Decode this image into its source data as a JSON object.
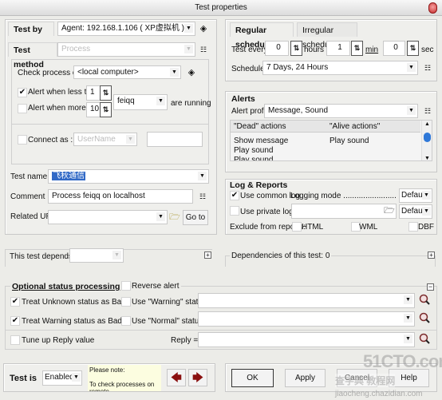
{
  "window": {
    "title": "Test properties"
  },
  "left": {
    "test_by": {
      "label": "Test by",
      "value": "Agent: 192.168.1.106 ( XP虚拟机 )"
    },
    "test_method": {
      "label": "Test method",
      "value": "Process"
    },
    "check_process_on": {
      "label": "Check process on",
      "value": "<local computer>"
    },
    "alert_less": {
      "label": "Alert when less than",
      "checked": true,
      "value": "1"
    },
    "alert_more": {
      "label": "Alert when more than",
      "checked": false,
      "value": "10"
    },
    "process_name": {
      "value": "feiqq",
      "suffix": "are running"
    },
    "connect_as": {
      "label": "Connect as :",
      "checked": false,
      "user_placeholder": "UserName",
      "password": ""
    },
    "test_name": {
      "label": "Test name",
      "value": "飞秋通信"
    },
    "comment": {
      "label": "Comment",
      "value": "Process feiqq on localhost"
    },
    "related_url": {
      "label": "Related URL",
      "value": "",
      "goto_label": "Go to"
    },
    "depends_on": {
      "label": "This test depends on",
      "value": ""
    }
  },
  "right": {
    "tabs": [
      {
        "label": "Regular schedule",
        "active": true
      },
      {
        "label": "Irregular schedule",
        "active": false
      }
    ],
    "test_every": {
      "label": "Test every",
      "hours": "0",
      "hours_label": "hours",
      "min": "1",
      "min_label": "min",
      "sec": "0",
      "sec_label": "sec"
    },
    "schedule": {
      "label": "Schedule",
      "value": "7 Days, 24 Hours"
    },
    "alerts": {
      "title": "Alerts",
      "profile_label": "Alert profile",
      "profile_value": "Message, Sound",
      "columns": [
        "\"Dead\" actions",
        "\"Alive actions\""
      ],
      "dead_actions": [
        "Show message",
        "Play sound",
        "Play sound"
      ],
      "alive_actions": [
        "Play sound"
      ]
    },
    "log": {
      "title": "Log & Reports",
      "use_common_log": {
        "label": "Use common log",
        "checked": true
      },
      "logging_mode_label": "Logging mode ...............................",
      "common_mode": "Default",
      "use_private_log": {
        "label": "Use private log",
        "checked": false,
        "path": ""
      },
      "private_mode": "Default",
      "exclude_label": "Exclude from reports:",
      "exclude": [
        {
          "label": "HTML",
          "checked": false
        },
        {
          "label": "WML",
          "checked": false
        },
        {
          "label": "DBF",
          "checked": false
        }
      ]
    },
    "dependencies": {
      "label": "Dependencies of this test: 0"
    }
  },
  "optional": {
    "title": "Optional status processing",
    "reverse_alert": {
      "label": "Reverse alert",
      "checked": false
    },
    "treat_unknown": {
      "label": "Treat Unknown status as Bad",
      "checked": true
    },
    "treat_warning": {
      "label": "Treat Warning status as Bad",
      "checked": true
    },
    "use_warning": {
      "label": "Use \"Warning\" status if",
      "checked": false,
      "value": ""
    },
    "use_normal": {
      "label": "Use \"Normal\" status if",
      "checked": false,
      "value": ""
    },
    "tune_reply": {
      "label": "Tune up Reply value",
      "checked": false
    },
    "reply": {
      "label": "Reply =",
      "value": ""
    }
  },
  "footer": {
    "test_is_label": "Test is",
    "test_is_value": "Enabled",
    "note_line1": "Please note:",
    "note_line2": "To check processes on remote",
    "ok_label": "OK",
    "apply_label": "Apply",
    "cancel_label": "Cancel",
    "help_label": "Help"
  },
  "watermark": {
    "line1": "51CTO.com",
    "line2": "查字典 教程网",
    "line3": "jiaocheng.chazidian.com"
  }
}
